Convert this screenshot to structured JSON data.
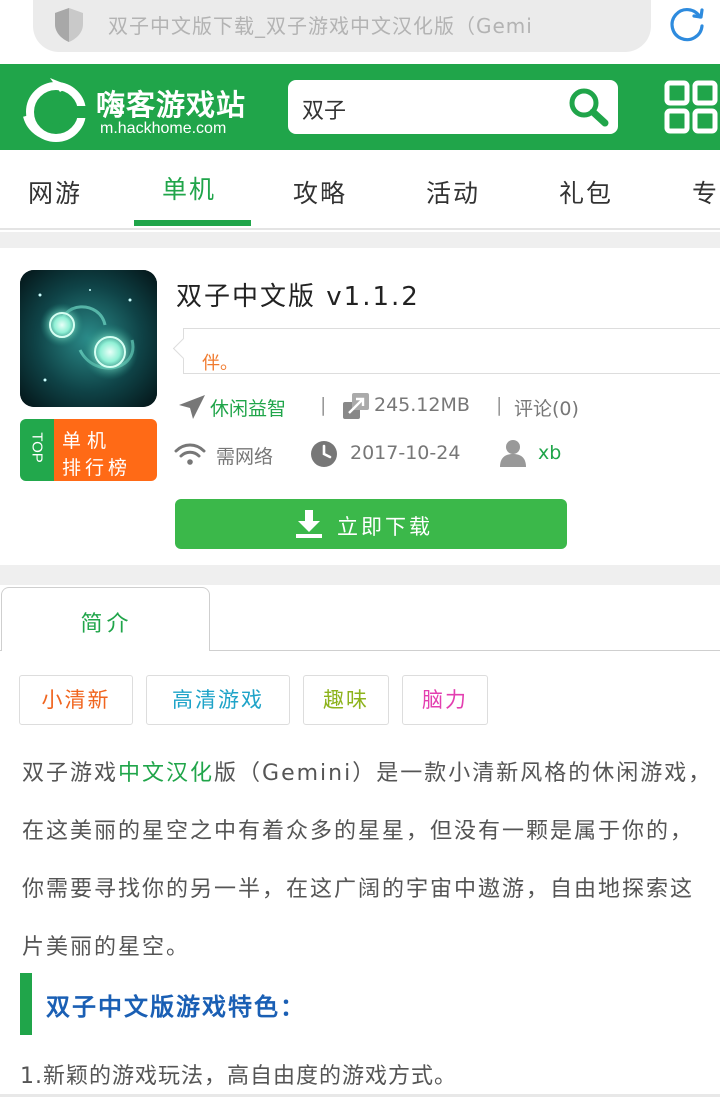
{
  "browser": {
    "url_text": "双子中文版下载_双子游戏中文汉化版（Gemi"
  },
  "header": {
    "logo_cn": "嗨客游戏站",
    "logo_en": "m.hackhome.com",
    "search_value": "双子"
  },
  "nav": {
    "items": [
      "网游",
      "单机",
      "攻略",
      "活动",
      "礼包",
      "专"
    ],
    "active_index": 1
  },
  "app": {
    "title": "双子中文版 v1.1.2",
    "quote": "伴。",
    "badge_top": "TOP",
    "badge_line1": "单机",
    "badge_line2": "排行榜",
    "category": "休闲益智",
    "size": "245.12MB",
    "comments": "评论(0)",
    "network": "需网络",
    "date": "2017-10-24",
    "author": "xb",
    "download_label": "立即下载"
  },
  "tabs": {
    "intro": "简介"
  },
  "tags": [
    {
      "label": "小清新",
      "color": "#f0651f"
    },
    {
      "label": "高清游戏",
      "color": "#1ea3c8"
    },
    {
      "label": "趣味",
      "color": "#8db31c"
    },
    {
      "label": "脑力",
      "color": "#e33fb0"
    }
  ],
  "description": {
    "part1": "双子游戏",
    "highlight": "中文汉化",
    "part2": "版（Gemini）是一款小清新风格的休闲游戏，在这美丽的星空之中有着众多的星星，但没有一颗是属于你的，你需要寻找你的另一半，在这广阔的宇宙中遨游，自由地探索这片美丽的星空。"
  },
  "section": {
    "title": "双子中文版游戏特色：",
    "feature1": "1.新颖的游戏玩法，高自由度的游戏方式。"
  },
  "colors": {
    "brand_green": "#20a54a",
    "download_green": "#3bb84a",
    "badge_orange": "#ff6a16",
    "section_blue": "#1a5fb4"
  }
}
